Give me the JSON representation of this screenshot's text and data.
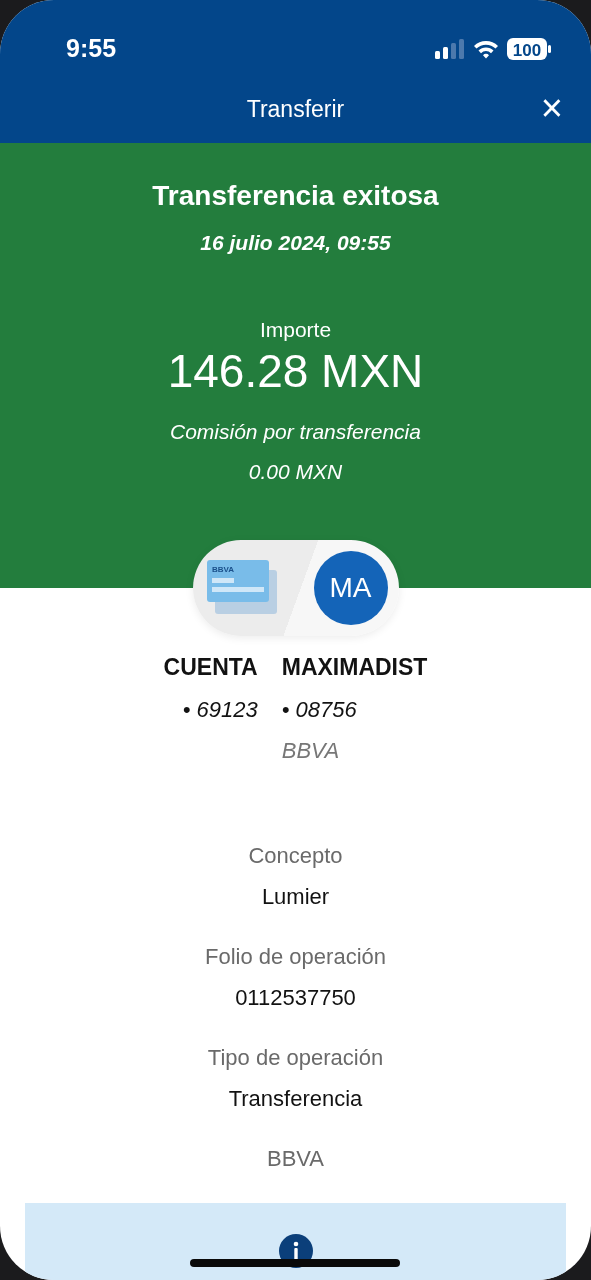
{
  "status_bar": {
    "time": "9:55",
    "battery": "100"
  },
  "header": {
    "title": "Transferir",
    "close": "×"
  },
  "result": {
    "title": "Transferencia exitosa",
    "date": "16 julio 2024, 09:55",
    "amount_label": "Importe",
    "amount": "146.28 MXN",
    "fee_label": "Comisión por transferencia",
    "fee": "0.00 MXN"
  },
  "transfer": {
    "card_logo": "BBVA",
    "avatar_initials": "MA",
    "origin": {
      "name": "CUENTA",
      "account": "• 69123"
    },
    "destination": {
      "name": "MAXIMADIST",
      "account": "• 08756",
      "bank": "BBVA"
    }
  },
  "details": [
    {
      "label": "Concepto",
      "value": "Lumier"
    },
    {
      "label": "Folio de operación",
      "value": "0112537750"
    },
    {
      "label": "Tipo de operación",
      "value": "Transferencia"
    }
  ],
  "bank_note": "BBVA"
}
